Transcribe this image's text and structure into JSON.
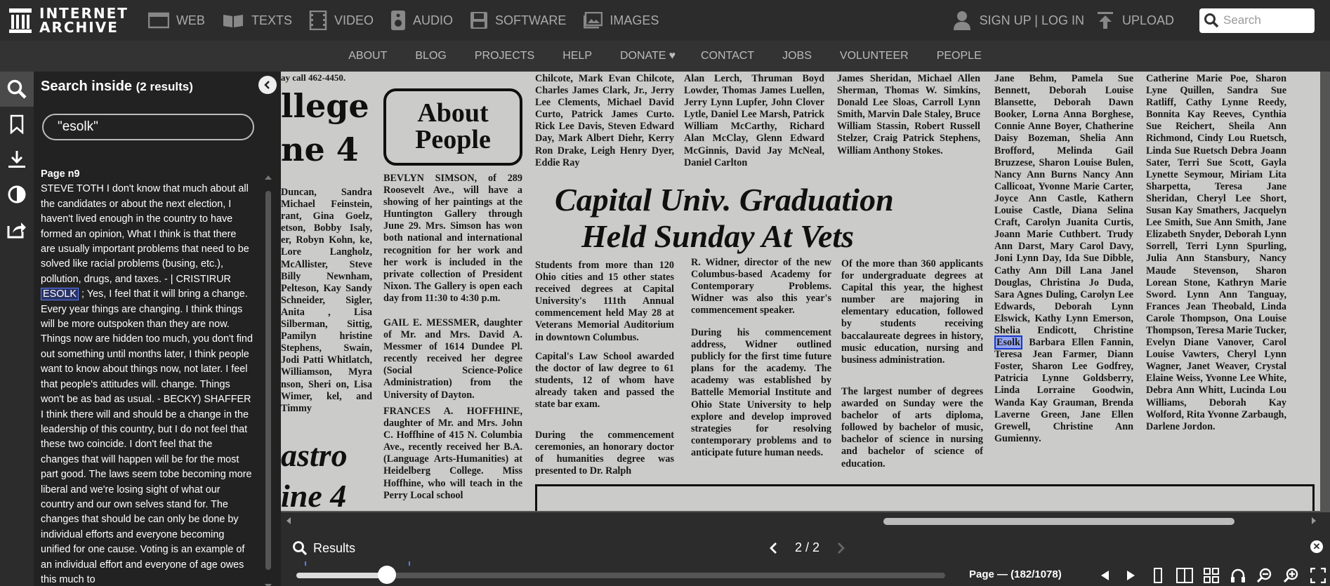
{
  "brand": {
    "line1": "INTERNET",
    "line2": "ARCHIVE"
  },
  "topnav": {
    "links": [
      {
        "label": "WEB",
        "icon": "web-icon"
      },
      {
        "label": "TEXTS",
        "icon": "texts-icon"
      },
      {
        "label": "VIDEO",
        "icon": "video-icon"
      },
      {
        "label": "AUDIO",
        "icon": "audio-icon"
      },
      {
        "label": "SOFTWARE",
        "icon": "software-icon"
      },
      {
        "label": "IMAGES",
        "icon": "images-icon"
      }
    ],
    "signup": "SIGN UP | LOG IN",
    "upload": "UPLOAD",
    "search_placeholder": "Search"
  },
  "subnav": {
    "about": "ABOUT",
    "blog": "BLOG",
    "projects": "PROJECTS",
    "help": "HELP",
    "donate": "DONATE",
    "donate_heart": "♥",
    "contact": "CONTACT",
    "jobs": "JOBS",
    "volunteer": "VOLUNTEER",
    "people": "PEOPLE"
  },
  "panel": {
    "title": "Search inside",
    "count": "(2 results)",
    "query": "\"esolk\"",
    "result": {
      "page": "Page n9",
      "text_before": "STEVE TOTH I don't know that much about all the candidates or about the next election, I haven't lived enough in the country to have formed an opinion, What I think is that there are usually important problems that need to be solved like racial problems (busing, etc.), pollution, drugs, and taxes. - | CRISTIRUR",
      "highlight": "ESOLK",
      "text_after": "; Yes, I feel that it will bring a change. Every year things are changing. I think things will be more outspoken than they are now. Things now are hidden too much, you don't find out something until months later, I think people want to know about things now, not later. I feel that people's attitudes will. change. Things won't be as bad as usual. - BECKY) SHAFFER I think there will and should be a change in the leadership of this country, but I do not feel that these two coincide. I don't feel that the changes that will happen will be for the most part good. The laws seem tobe becoming more liberal and we're losing sight of what our country and our own selves stand for. The changes that should be can only be done by individual efforts and everyone becoming unified for one cause. Voting is an example of an individual effort and everyone of age owes this much to"
    }
  },
  "paper": {
    "col0_top": "ay call 462-4450.",
    "col0_big1": "llege",
    "col0_big2": "ne 4",
    "col0_text": "Duncan, Sandra Michael Feinstein, rant, Gina Goelz, etson, Bobby Isaly, er, Robyn Kohn, ke, Lore Langholz, McAllister, Steve Billy Newnham, Pelteson, Kay Sandy Schneider, Sigler, Anita , Lisa Silberman, Sittig, Pamilyn hristine Stephens, Swain, Jodi Patti Whitlatch, Williamson, Myra nson, Sheri on, Lisa Wimer, kel, and Timmy",
    "col0_big3": "astro",
    "col0_big4": "ine 4",
    "about_line1": "About",
    "about_line2": "People",
    "col1_text": "BEVLYN SIMSON, of 289 Roosevelt Ave., will have a showing of her paintings at the Huntington Gallery through June 29. Mrs. Simson has won both national and international recognition for her work and her work is included in the private collection of President Nixon. The Gallery is open each day from 11:30 to 4:30 p.m.",
    "col1_text2": "GAIL E. MESSMER, daughter of Mr. and Mrs. David A. Messmer of 1614 Dundee Pl. recently received her degree (Social Science-Police Administration) from the University of Dayton.",
    "col1_text3": "FRANCES A. HOFFHINE, daughter of Mr. and Mrs. John C. Hoffhine of 415 N. Columbia Ave., recently received her B.A. (Language Arts-Humanities) at Heidelberg College. Miss Hoffhine, who will teach in the Perry Local school",
    "col2_top": "Chilcote, Mark Evan Chilcote, Charles James Clark, Jr., Jerry Lee Clements, Michael David Curto, Patrick James Curto. Rick Lee Davis, Steven Edward Day, Mark Albert Diehr, Kerry Ron Drake, Leigh Henry Dyer, Eddie Ray",
    "col3_top": "Alan Lerch, Thruman Boyd Lowder, Thomas James Luellen, Jerry Lynn Lupfer, John Clover Lytle, Daniel Lee Marsh, Patrick William McCarthy, Richard Alan McClay, Glenn Edward McGinnis, David Jay McNeal, Daniel Carlton",
    "col4_top": "James Sheridan, Michael Allen Sherman, Thomas W. Simkins, Donald Lee Sloas, Carroll Lynn Smith, Marvin Dale Staley, Bruce William Stassin, Robert Russell Stelzer, Craig Patrick Stephens, William Anthony Stokes.",
    "headline1": "Capital Univ. Graduation",
    "headline2": "Held Sunday At Vets",
    "col2_body": "Students from more than 120 Ohio cities and 15 other states received degrees at Capital University's 111th Annual commencement held May 28 at Veterans Memorial Auditorium in downtown Columbus.",
    "col2_body2": "Capital's Law School awarded the doctor of law degree to 61 students, 12 of whom have already taken and passed the state bar exam.",
    "col2_body3": "During the commencement ceremonies, an honorary doctor of humanities degree was presented to Dr. Ralph",
    "col3_body": "R. Widner, director of the new Columbus-based Academy for Contemporary Problems. Widner was also this year's commencement speaker.",
    "col3_body2": "During his commencement address, Widner outlined publicly for the first time future plans for the academy. The academy was established by Battelle Memorial Institute and Ohio State University to help explore and develop improved strategies for resolving contemporary problems and to anticipate future human needs.",
    "col4_body": "Of the more than 360 applicants for undergraduate degrees at Capital this year, the highest number are majoring in elementary education, followed by students receiving baccalaureate degrees in history, music education, nursing and business administration.",
    "col4_body2": "The largest number of degrees awarded on Sunday were the bachelor of arts diploma, followed by bachelor of music, bachelor of science in nursing and bachelor of science of education.",
    "col5_text_a": "Jane Behm, Pamela Sue Bennett, Deborah Louise Blansette, Deborah Dawn Booker, Lorna Anna Borghese, Connie Anne Boyer, Chatherine Daisy Bozeman, Shelia Ann Brofford, Melinda Gail Bruzzese, Sharon Louise Bulen, Nancy Ann Burns Nancy Ann Callicoat, Yvonne Marie Carter, Joyce Ann Castle, Kathern Louise Castle, Diana Selina Craft, Carolyn Juanita Curtis, Joann Marie Cuthbert. Trudy Ann Darst, Mary Carol Davy, Joni Lynn Day, Ida Sue Dibble, Cathy Ann Dill Lana Janel Douglas, Christina Jo Duda, Sara Agnes Duling, Carolyn Lee Edwards, Deborah Lynn Elswick, Kathy Lynn Emerson, Shelia Endicott, Christine",
    "col5_hit": "Esolk",
    "col5_text_b": "Barbara Ellen Fannin, Teresa Jean Farmer, Diann Foster, Sharon Lee Godfrey, Patricia Lynne Goldsberry, Linda Lorraine Goodwin, Wanda Kay Grauman, Brenda Laverne Green, Jane Ellen Grewell, Christine Ann Gumienny.",
    "col6_text": "Catherine Marie Poe, Sharon Lyne Quillen, Sandra Sue Ratliff, Cathy Lynne Reedy, Bonnita Kay Reeves, Cynthia Sue Reichert, Sheila Ann Richmond, Cindy Lou Ruetsch, Linda Sue Ruetsch Debra Joann Sater, Terri Sue Scott, Gayla Lynette Seymour, Miriam Lita Sharpetta, Teresa Jane Sheridan, Cheryl Lee Short, Susan Kay Smathers, Jacquelyn Lee Smith, Sue Ann Smith, Jane Elizabeth Snyder, Deborah Lynn Sorrell, Terri Lynn Spurling, Julia Ann Stansbury, Nancy Maude Stevenson, Sharon Lorean Stone, Kathryn Marie Sword. Lynn Ann Tanguay, Frances Jean Theobald, Linda Carole Thompson, Ona Louise Thompson, Teresa Marie Tucker, Evelyn Diane Vanover, Carol Louise Vawters, Cheryl Lynn Wagner, Janet Weaver, Crystal Elaine Weiss, Yvonne Lee White, Debra Ann Whitt, Lucinda Lou Williams, Deborah Kay Wolford, Rita Yvonne Zarbaugh, Darlene Jordon."
  },
  "bottombar": {
    "results_label": "Results",
    "pager": "2 / 2",
    "close": "✕",
    "page_info": "Page — (182/1078)",
    "slider_fraction": 0.14
  }
}
